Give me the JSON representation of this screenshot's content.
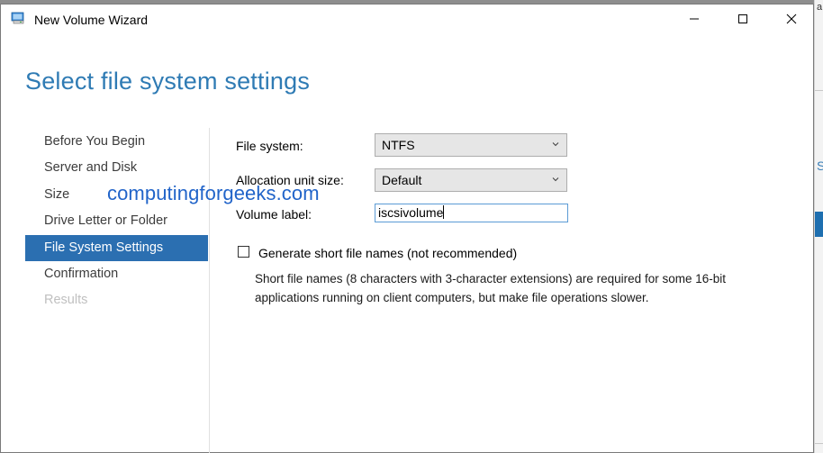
{
  "window": {
    "title": "New Volume Wizard"
  },
  "page": {
    "heading": "Select file system settings"
  },
  "nav": {
    "items": [
      {
        "label": "Before You Begin",
        "state": "normal"
      },
      {
        "label": "Server and Disk",
        "state": "normal"
      },
      {
        "label": "Size",
        "state": "normal"
      },
      {
        "label": "Drive Letter or Folder",
        "state": "normal"
      },
      {
        "label": "File System Settings",
        "state": "selected"
      },
      {
        "label": "Confirmation",
        "state": "normal"
      },
      {
        "label": "Results",
        "state": "disabled"
      }
    ]
  },
  "watermark": {
    "text": "computingforgeeks.com"
  },
  "form": {
    "file_system": {
      "label": "File system:",
      "value": "NTFS"
    },
    "allocation_unit": {
      "label": "Allocation unit size:",
      "value": "Default"
    },
    "volume_label": {
      "label": "Volume label:",
      "value": "iscsivolume"
    },
    "short_names": {
      "label": "Generate short file names (not recommended)",
      "checked": false,
      "description": "Short file names (8 characters with 3-character extensions) are required for some 16-bit applications running on client computers, but make file operations slower."
    }
  },
  "colors": {
    "accent": "#2b6fb1",
    "heading": "#2f7bb4",
    "watermark": "#2164c9"
  },
  "icons": {
    "app": "volume-wizard-icon",
    "minimize": "minimize-icon",
    "maximize": "maximize-icon",
    "close": "close-icon",
    "dropdown": "chevron-down-icon"
  }
}
